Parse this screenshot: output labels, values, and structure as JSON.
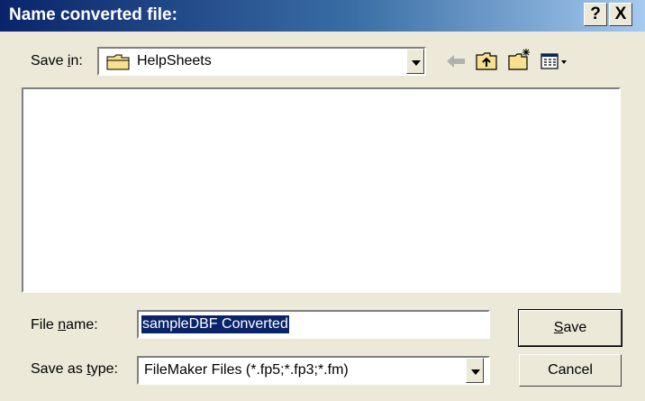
{
  "window": {
    "title": "Name converted file:",
    "help_label": "?",
    "close_label": "X"
  },
  "save_in": {
    "label_prefix": "Save ",
    "label_accel": "i",
    "label_suffix": "n:",
    "folder": "HelpSheets"
  },
  "file_name": {
    "label_prefix": "File ",
    "label_accel": "n",
    "label_suffix": "ame:",
    "value": "sampleDBF Converted"
  },
  "save_as_type": {
    "label_prefix": "Save as ",
    "label_accel": "t",
    "label_suffix": "ype:",
    "value": "FileMaker Files (*.fp5;*.fp3;*.fm)"
  },
  "buttons": {
    "save_accel": "S",
    "save_suffix": "ave",
    "cancel": "Cancel"
  },
  "colors": {
    "titlebar_start": "#0a246a",
    "titlebar_end": "#a6caf0",
    "dialog_bg": "#ece9d8",
    "selection": "#0a246a"
  }
}
